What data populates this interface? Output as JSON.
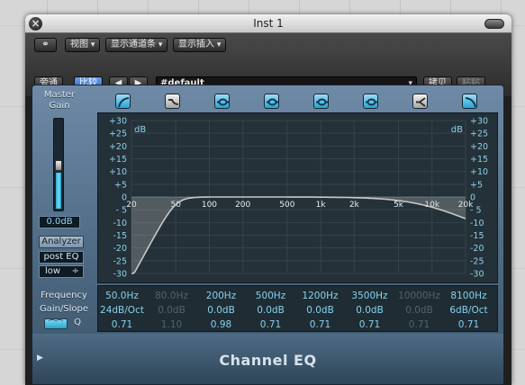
{
  "window": {
    "title": "Inst 1"
  },
  "toolbar": {
    "view": "视图",
    "channel_strip": "显示通道条",
    "insert": "显示插入",
    "bypass": "旁通",
    "compare": "比较",
    "preset": "#default",
    "copy": "拷贝",
    "paste": "粘贴"
  },
  "plugin": {
    "name": "Channel EQ",
    "master_gain_label": "Master Gain",
    "gain_value": "0.0dB",
    "analyzer": "Analyzer",
    "post_eq": "post EQ",
    "resolution": "low",
    "param_labels": {
      "frequency": "Frequency",
      "gain_slope": "Gain/Slope",
      "q": "Q"
    },
    "bands": [
      {
        "icon": "low-cut-icon",
        "on": true,
        "freq": "50.0Hz",
        "gain": "24dB/Oct",
        "q": "0.71"
      },
      {
        "icon": "low-shelf-icon",
        "on": false,
        "freq": "80.0Hz",
        "gain": "0.0dB",
        "q": "1.10"
      },
      {
        "icon": "bell-icon",
        "on": true,
        "freq": "200Hz",
        "gain": "0.0dB",
        "q": "0.98"
      },
      {
        "icon": "bell-icon",
        "on": true,
        "freq": "500Hz",
        "gain": "0.0dB",
        "q": "0.71"
      },
      {
        "icon": "bell-icon",
        "on": true,
        "freq": "1200Hz",
        "gain": "0.0dB",
        "q": "0.71"
      },
      {
        "icon": "bell-icon",
        "on": true,
        "freq": "3500Hz",
        "gain": "0.0dB",
        "q": "0.71"
      },
      {
        "icon": "high-shelf-icon",
        "on": false,
        "freq": "10000Hz",
        "gain": "0.0dB",
        "q": "0.71"
      },
      {
        "icon": "high-cut-icon",
        "on": true,
        "freq": "8100Hz",
        "gain": "6dB/Oct",
        "q": "0.71"
      }
    ],
    "display": {
      "unit": "dB",
      "db_ticks": [
        "+30",
        "+25",
        "+20",
        "+15",
        "+10",
        "+5",
        "0",
        "- 5",
        "-10",
        "-15",
        "-20",
        "-25",
        "-30"
      ],
      "freq_ticks": [
        "20",
        "50",
        "100",
        "200",
        "500",
        "1k",
        "2k",
        "5k",
        "10k",
        "20k"
      ]
    }
  },
  "colors": {
    "accent": "#2aa6cf",
    "curve": "#c8c8c8"
  }
}
